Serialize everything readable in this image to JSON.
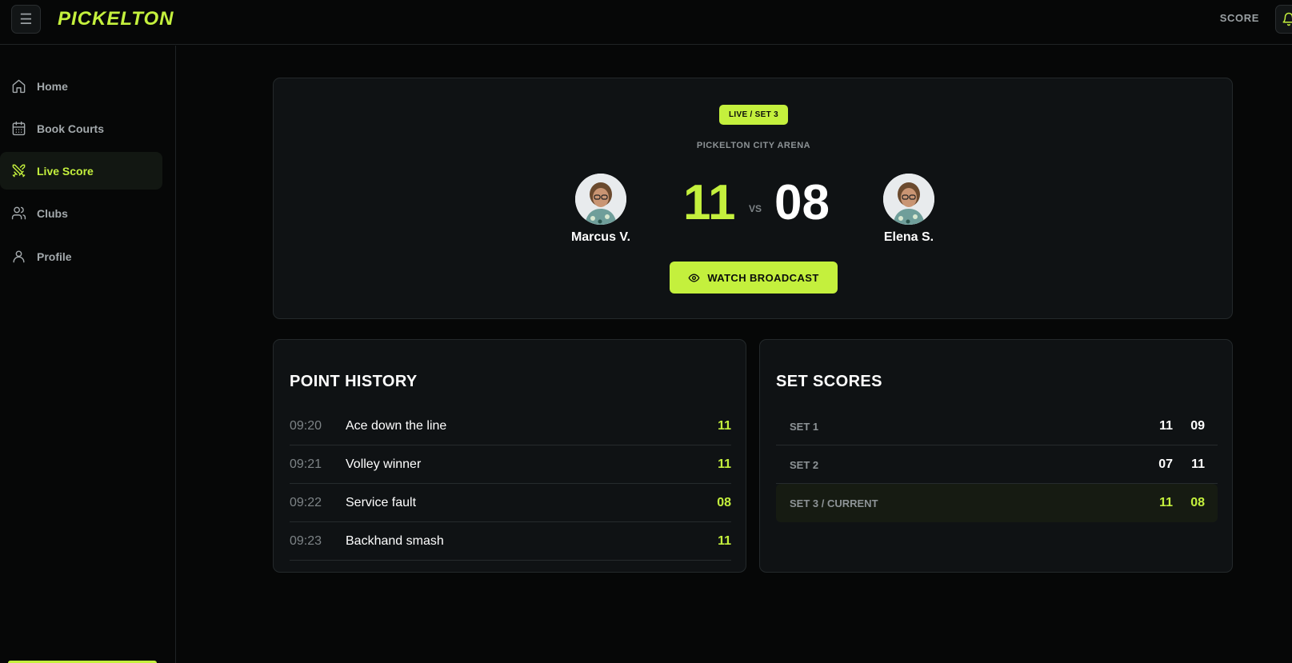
{
  "app": {
    "brand": "PICKELTON",
    "menu_icon": "hamburger-icon"
  },
  "header": {
    "score_link": "SCORE",
    "bell_icon": "bell-icon"
  },
  "sidebar": {
    "items": [
      {
        "label": "Home",
        "icon": "home-icon",
        "active": false
      },
      {
        "label": "Book Courts",
        "icon": "calendar-icon",
        "active": false
      },
      {
        "label": "Live Score",
        "icon": "swords-icon",
        "active": true
      },
      {
        "label": "Clubs",
        "icon": "users-icon",
        "active": false
      },
      {
        "label": "Profile",
        "icon": "user-icon",
        "active": false
      }
    ]
  },
  "match": {
    "badge": "LIVE / SET 3",
    "venue": "PICKELTON CITY ARENA",
    "player_a": {
      "name": "Marcus V.",
      "score": "11"
    },
    "player_b": {
      "name": "Elena S.",
      "score": "08"
    },
    "vs": "VS",
    "watch_button": "WATCH BROADCAST"
  },
  "point_history": {
    "title": "POINT HISTORY",
    "rows": [
      {
        "time": "09:20",
        "desc": "Ace down the line",
        "score": "11"
      },
      {
        "time": "09:21",
        "desc": "Volley winner",
        "score": "11"
      },
      {
        "time": "09:22",
        "desc": "Service fault",
        "score": "08"
      },
      {
        "time": "09:23",
        "desc": "Backhand smash",
        "score": "11"
      }
    ]
  },
  "set_scores": {
    "title": "SET SCORES",
    "rows": [
      {
        "label": "SET 1",
        "a": "11",
        "b": "09",
        "current": false
      },
      {
        "label": "SET 2",
        "a": "07",
        "b": "11",
        "current": false
      },
      {
        "label": "SET 3 / CURRENT",
        "a": "11",
        "b": "08",
        "current": true
      }
    ]
  },
  "colors": {
    "accent": "#c4f03d",
    "background": "#060707",
    "card": "#0f1214"
  }
}
